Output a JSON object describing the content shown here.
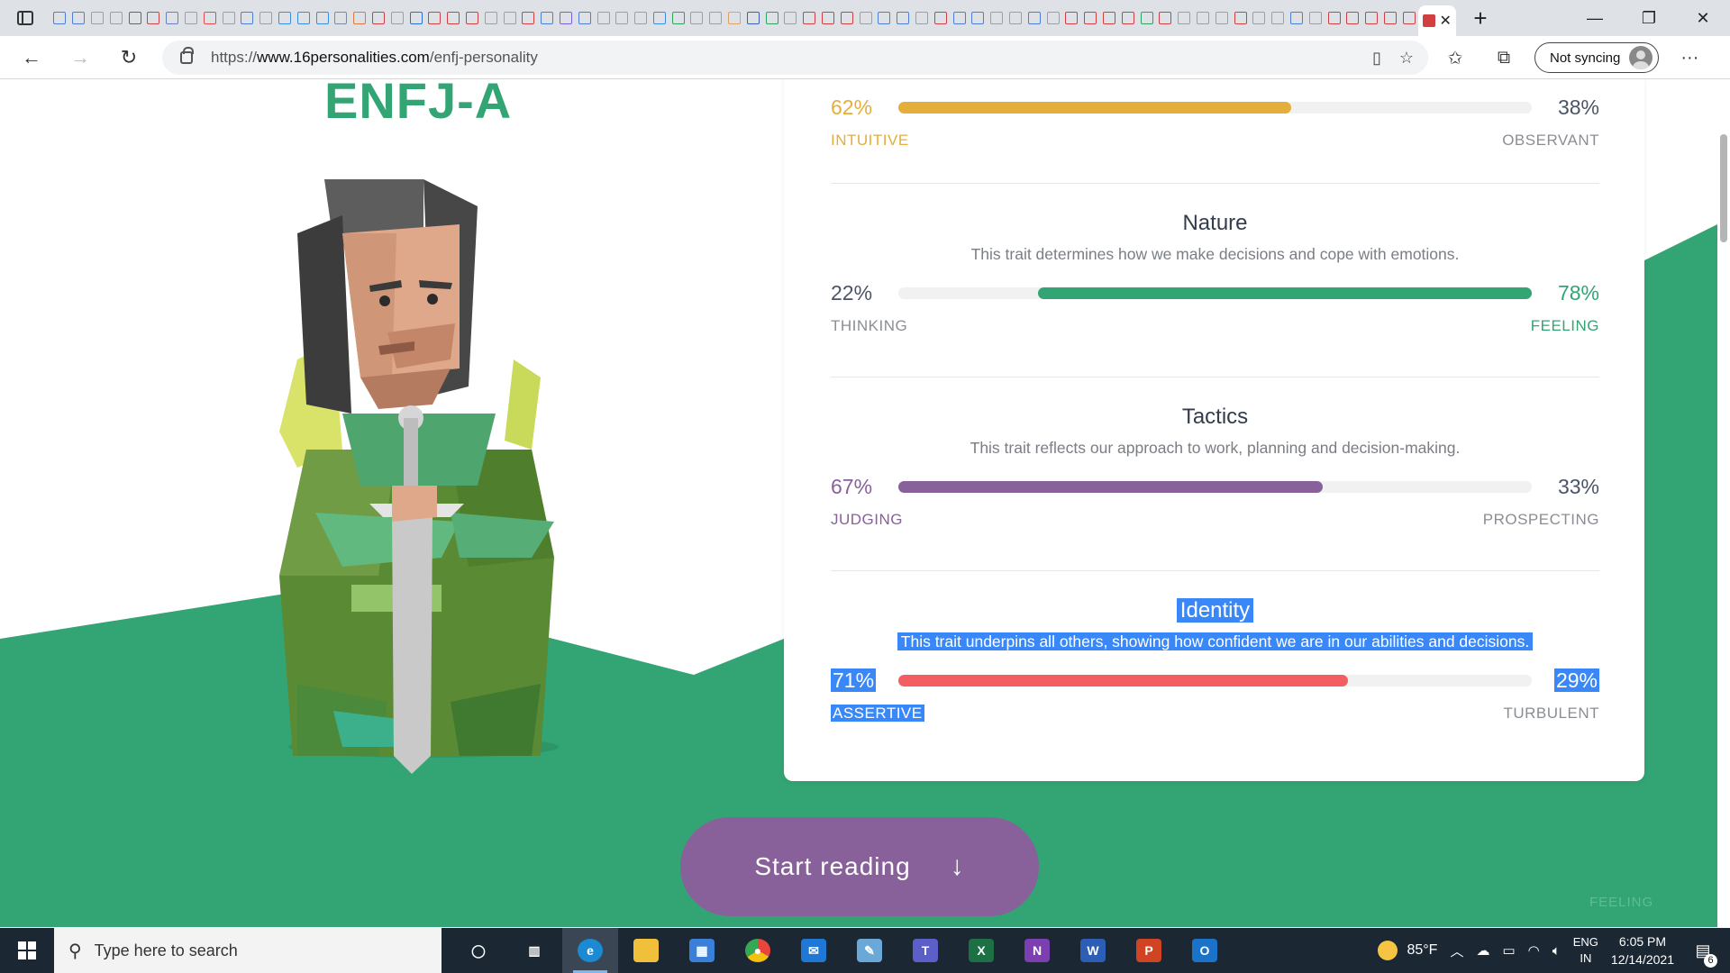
{
  "browser": {
    "tab_favicon_colors": [
      "#4a7fd4",
      "#4a7fd4",
      "#9aa0a6",
      "#9aa0a6",
      "#666",
      "#c44",
      "#6a7fbf",
      "#9aa0a6",
      "#e04a4a",
      "#9aa0a6",
      "#4a7fd4",
      "#9aa0a6",
      "#3a8ee0",
      "#3a8ee0",
      "#3a8ee0",
      "#7a8aa0",
      "#e07a3a",
      "#d04040",
      "#9aa0a6",
      "#2a6fd8",
      "#d04040",
      "#d04040",
      "#d04040",
      "#9aa0a6",
      "#9aa0a6",
      "#d04040",
      "#4a7fd4",
      "#7a5fd8",
      "#4a7fd4",
      "#9aa0a6",
      "#9aa0a6",
      "#9aa0a6",
      "#3a8ee0",
      "#2ea060",
      "#9aa0a6",
      "#9aa0a6",
      "#e0a060",
      "#3a60c0",
      "#2ea060",
      "#9aa0a6",
      "#d04040",
      "#d04040",
      "#d04040",
      "#9aa0a6",
      "#4a7fd4",
      "#4a7fd4",
      "#9aa0a6",
      "#d04040",
      "#4a7fd4",
      "#4a7fd4",
      "#9aa0a6",
      "#9aa0a6",
      "#4a7fd4",
      "#9aa0a6",
      "#d04040",
      "#d04040",
      "#d04040",
      "#d04040",
      "#2ea060",
      "#d04040",
      "#9aa0a6",
      "#9aa0a6",
      "#9aa0a6",
      "#d04040",
      "#9aa0a6",
      "#9aa0a6",
      "#4a7fd4",
      "#9aa0a6",
      "#d04040",
      "#d04040",
      "#d04040",
      "#d04040",
      "#d04040"
    ],
    "active_tab_close": "✕",
    "new_tab": "+",
    "window_controls": [
      "—",
      "❐",
      "✕"
    ],
    "url_prefix": "https://",
    "url_domain": "www.16personalities.com",
    "url_path": "/enfj-personality",
    "sync_label": "Not syncing",
    "more": "···"
  },
  "page": {
    "type_code": "ENFJ-A",
    "traits": [
      {
        "title": "",
        "description": "",
        "left_pct": "62%",
        "right_pct": "38%",
        "left_label": "INTUITIVE",
        "right_label": "OBSERVANT",
        "fill_from": "left",
        "fill_fraction": 0.62,
        "color": "#e4ae3a",
        "pct_color_side": "left"
      },
      {
        "title": "Nature",
        "description": "This trait determines how we make decisions and cope with emotions.",
        "left_pct": "22%",
        "right_pct": "78%",
        "left_label": "THINKING",
        "right_label": "FEELING",
        "fill_from": "right",
        "fill_fraction": 0.78,
        "color": "#33a474",
        "pct_color_side": "right"
      },
      {
        "title": "Tactics",
        "description": "This trait reflects our approach to work, planning and decision-making.",
        "left_pct": "67%",
        "right_pct": "33%",
        "left_label": "JUDGING",
        "right_label": "PROSPECTING",
        "fill_from": "left",
        "fill_fraction": 0.67,
        "color": "#88619a",
        "pct_color_side": "left"
      },
      {
        "title": "Identity",
        "description": "This trait underpins all others, showing how confident we are in our abilities and decisions.",
        "left_pct": "71%",
        "right_pct": "29%",
        "left_label": "ASSERTIVE",
        "right_label": "TURBULENT",
        "fill_from": "left",
        "fill_fraction": 0.71,
        "color": "#f25e62",
        "pct_color_side": "left"
      }
    ],
    "start_reading": "Start reading",
    "ghost_label": "FEELING",
    "colors": {
      "green": "#33a474",
      "purple": "#88619a"
    }
  },
  "taskbar": {
    "search_placeholder": "Type here to search",
    "apps": [
      {
        "name": "cortana",
        "color": "transparent",
        "glyph": "◯"
      },
      {
        "name": "task-view",
        "color": "transparent",
        "glyph": "▥"
      },
      {
        "name": "edge",
        "color": "#1b8ad3",
        "glyph": "e"
      },
      {
        "name": "file-explorer",
        "color": "#f0c03a",
        "glyph": ""
      },
      {
        "name": "store",
        "color": "#3a7fd8",
        "glyph": "▦"
      },
      {
        "name": "chrome",
        "color": "#e8453c",
        "glyph": "●"
      },
      {
        "name": "mail",
        "color": "#1f78d6",
        "glyph": "✉"
      },
      {
        "name": "notepad",
        "color": "#6aa8d8",
        "glyph": "✎"
      },
      {
        "name": "teams",
        "color": "#5b5fc7",
        "glyph": "T"
      },
      {
        "name": "excel",
        "color": "#1d7044",
        "glyph": "X"
      },
      {
        "name": "onenote",
        "color": "#7b3fb2",
        "glyph": "N"
      },
      {
        "name": "word",
        "color": "#2b5eb4",
        "glyph": "W"
      },
      {
        "name": "powerpoint",
        "color": "#d04423",
        "glyph": "P"
      },
      {
        "name": "outlook",
        "color": "#1a73c8",
        "glyph": "O"
      }
    ],
    "temperature": "85°F",
    "lang_top": "ENG",
    "lang_bottom": "IN",
    "time": "6:05 PM",
    "date": "12/14/2021",
    "notification_count": "6"
  }
}
